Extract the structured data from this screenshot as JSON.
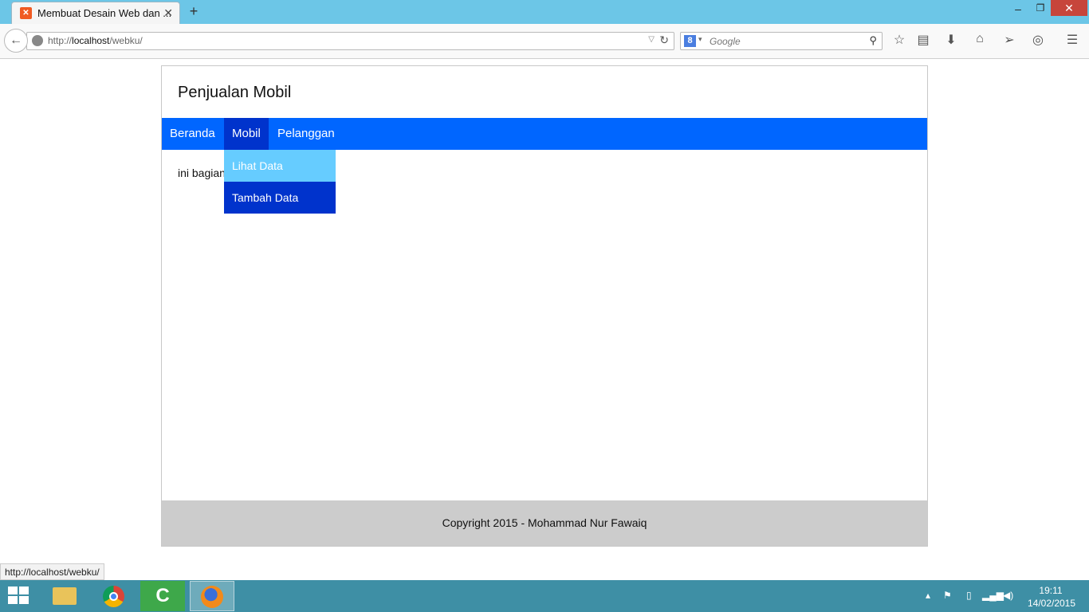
{
  "browser": {
    "tab_title": "Membuat Desain Web dan ...",
    "new_tab": "+",
    "url_prefix": "http://",
    "url_host": "localhost",
    "url_path": "/webku/",
    "search_placeholder": "Google",
    "search_engine_letter": "8"
  },
  "page": {
    "site_title": "Penjualan Mobil",
    "menu": [
      "Beranda",
      "Mobil",
      "Pelanggan"
    ],
    "dropdown": [
      "Lihat Data",
      "Tambah Data"
    ],
    "content_text": "ini bagian",
    "footer": "Copyright 2015 - Mohammad Nur Fawaiq"
  },
  "status_bar_url": "http://localhost/webku/",
  "taskbar": {
    "time": "19:11",
    "date": "14/02/2015"
  },
  "colors": {
    "menu_bg": "#0066ff",
    "menu_active": "#0033cc",
    "dropdown_hover": "#66ccff",
    "footer_bg": "#cccccc",
    "titlebar": "#6cc6e7",
    "taskbar": "#3e8fa5"
  }
}
